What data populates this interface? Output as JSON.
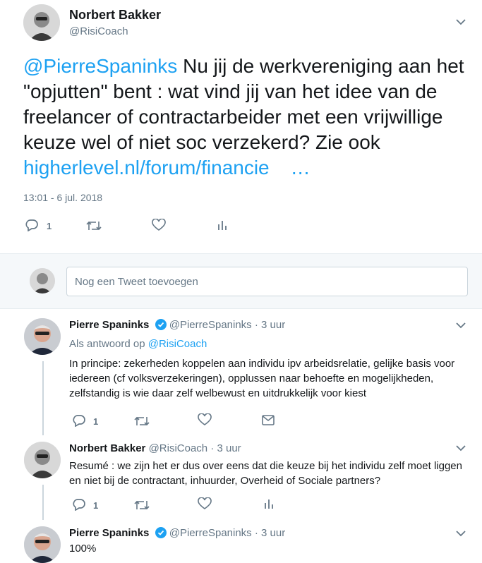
{
  "main_tweet": {
    "author_name": "Norbert Bakker",
    "author_handle": "@RisiCoach",
    "mention": "@PierreSpaninks",
    "text_part1": " Nu jij de werkvereniging aan het \"opjutten\" bent : wat vind jij van het idee van de freelancer of contractarbeider met een vrijwillige keuze wel of niet soc verzekerd? Zie ook ",
    "link_text": "higherlevel.nl/forum/financie",
    "ellipsis": "…",
    "timestamp": "13:01 - 6 jul. 2018",
    "reply_count": "1"
  },
  "compose": {
    "placeholder": "Nog een Tweet toevoegen"
  },
  "replies": [
    {
      "author_name": "Pierre Spaninks",
      "author_handle": "@PierreSpaninks",
      "time": "· 3 uur",
      "reply_to_label": "Als antwoord op ",
      "reply_to_handle": "@RisiCoach",
      "text": "In principe: zekerheden koppelen aan individu ipv arbeidsrelatie, gelijke basis voor iedereen (cf volksverzekeringen), opplussen naar behoefte en mogelijkheden, zelfstandig is wie daar zelf welbewust en uitdrukkelijk voor kiest",
      "reply_count": "1"
    },
    {
      "author_name": "Norbert Bakker",
      "author_handle": "@RisiCoach",
      "time": "· 3 uur",
      "text": "Resumé : we zijn het er dus over eens dat die keuze bij het individu zelf moet liggen en niet bij de contractant, inhuurder, Overheid of Sociale partners?",
      "reply_count": "1"
    },
    {
      "author_name": "Pierre Spaninks",
      "author_handle": "@PierreSpaninks",
      "time": "· 3 uur",
      "text": "100%"
    }
  ],
  "colors": {
    "accent": "#1da1f2",
    "muted": "#657786",
    "text": "#14171a",
    "border": "#e6ecf0"
  }
}
